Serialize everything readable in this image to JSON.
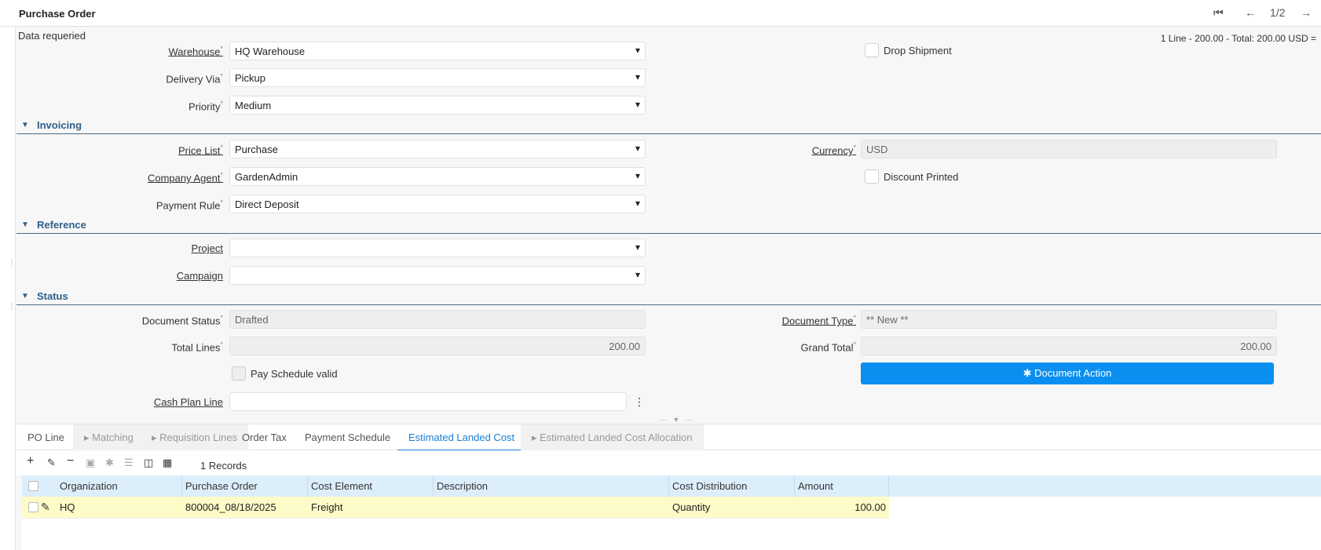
{
  "window": {
    "title": "Purchase Order",
    "record_position": "1/2",
    "data_required": "Data requeried",
    "summary": "1 Line - 200.00 - Total: 200.00 USD ="
  },
  "icons": {
    "first": "⏮",
    "prev": "←",
    "next": "→",
    "dropdown": "▾",
    "caret": "▼",
    "more": "⋮",
    "gear": "✱"
  },
  "delivery": {
    "warehouse_label": "Warehouse",
    "warehouse_value": "HQ Warehouse",
    "drop_shipment_label": "Drop Shipment",
    "delivery_via_label": "Delivery Via",
    "delivery_via_value": "Pickup",
    "priority_label": "Priority",
    "priority_value": "Medium"
  },
  "invoicing": {
    "title": "Invoicing",
    "price_list_label": "Price List",
    "price_list_value": "Purchase",
    "currency_label": "Currency",
    "currency_value": "USD",
    "company_agent_label": "Company Agent",
    "company_agent_value": "GardenAdmin",
    "discount_printed_label": "Discount Printed",
    "payment_rule_label": "Payment Rule",
    "payment_rule_value": "Direct Deposit"
  },
  "reference": {
    "title": "Reference",
    "project_label": "Project",
    "project_value": "",
    "campaign_label": "Campaign",
    "campaign_value": ""
  },
  "status": {
    "title": "Status",
    "document_status_label": "Document Status",
    "document_status_value": "Drafted",
    "document_type_label": "Document Type",
    "document_type_value": "** New **",
    "total_lines_label": "Total Lines",
    "total_lines_value": "200.00",
    "grand_total_label": "Grand Total",
    "grand_total_value": "200.00",
    "pay_schedule_label": "Pay Schedule valid",
    "document_action_label": "Document Action",
    "cash_plan_label": "Cash Plan Line",
    "cash_plan_value": ""
  },
  "tabs": [
    {
      "label": "PO Line"
    },
    {
      "label": "Matching"
    },
    {
      "label": "Requisition Lines"
    },
    {
      "label": "Order Tax"
    },
    {
      "label": "Payment Schedule"
    },
    {
      "label": "Estimated Landed Cost"
    },
    {
      "label": "Estimated Landed Cost Allocation"
    }
  ],
  "toolbar": {
    "new": "+",
    "edit": "✎",
    "delete": "−",
    "save": "▣",
    "process": "✱",
    "checklist": "☰",
    "split": "◫",
    "grid": "▦",
    "records": "1 Records"
  },
  "grid": {
    "columns": [
      "Organization",
      "Purchase Order",
      "Cost Element",
      "Description",
      "Cost Distribution",
      "Amount"
    ],
    "rows": [
      {
        "organization": "HQ",
        "purchase_order": "800004_08/18/2025",
        "cost_element": "Freight",
        "description": "",
        "cost_distribution": "Quantity",
        "amount": "100.00"
      }
    ]
  }
}
